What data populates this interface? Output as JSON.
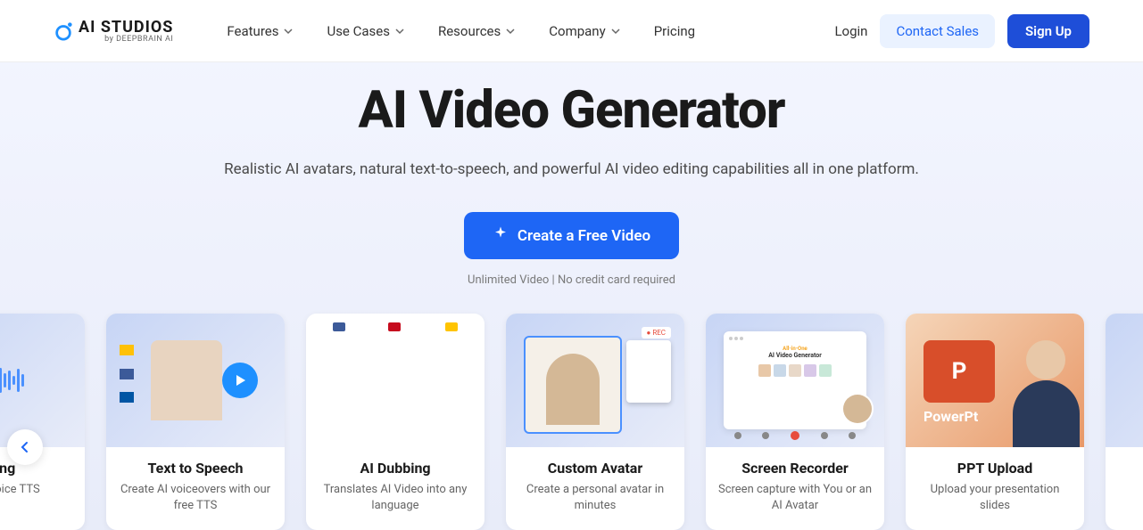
{
  "header": {
    "logo_text": "AI STUDIOS",
    "logo_sub": "by DEEPBRAIN AI",
    "nav": [
      "Features",
      "Use Cases",
      "Resources",
      "Company",
      "Pricing"
    ],
    "login": "Login",
    "contact": "Contact Sales",
    "signup": "Sign Up"
  },
  "hero": {
    "title": "AI Video Generator",
    "subtitle": "Realistic AI avatars, natural text-to-speech, and powerful AI video editing capabilities all in one platform.",
    "cta": "Create a Free Video",
    "note": "Unlimited Video | No credit card required"
  },
  "cards": [
    {
      "title": "loning",
      "desc": "own AI voice TTS"
    },
    {
      "title": "Text to Speech",
      "desc": "Create AI voiceovers with our free TTS"
    },
    {
      "title": "AI Dubbing",
      "desc": "Translates AI Video into any language"
    },
    {
      "title": "Custom Avatar",
      "desc": "Create a personal avatar in minutes"
    },
    {
      "title": "Screen Recorder",
      "desc": "Screen capture with You or an AI Avatar"
    },
    {
      "title": "PPT Upload",
      "desc": "Upload your presentation slides"
    },
    {
      "title": "",
      "desc": ""
    }
  ],
  "ppt_label": "PowerPt"
}
